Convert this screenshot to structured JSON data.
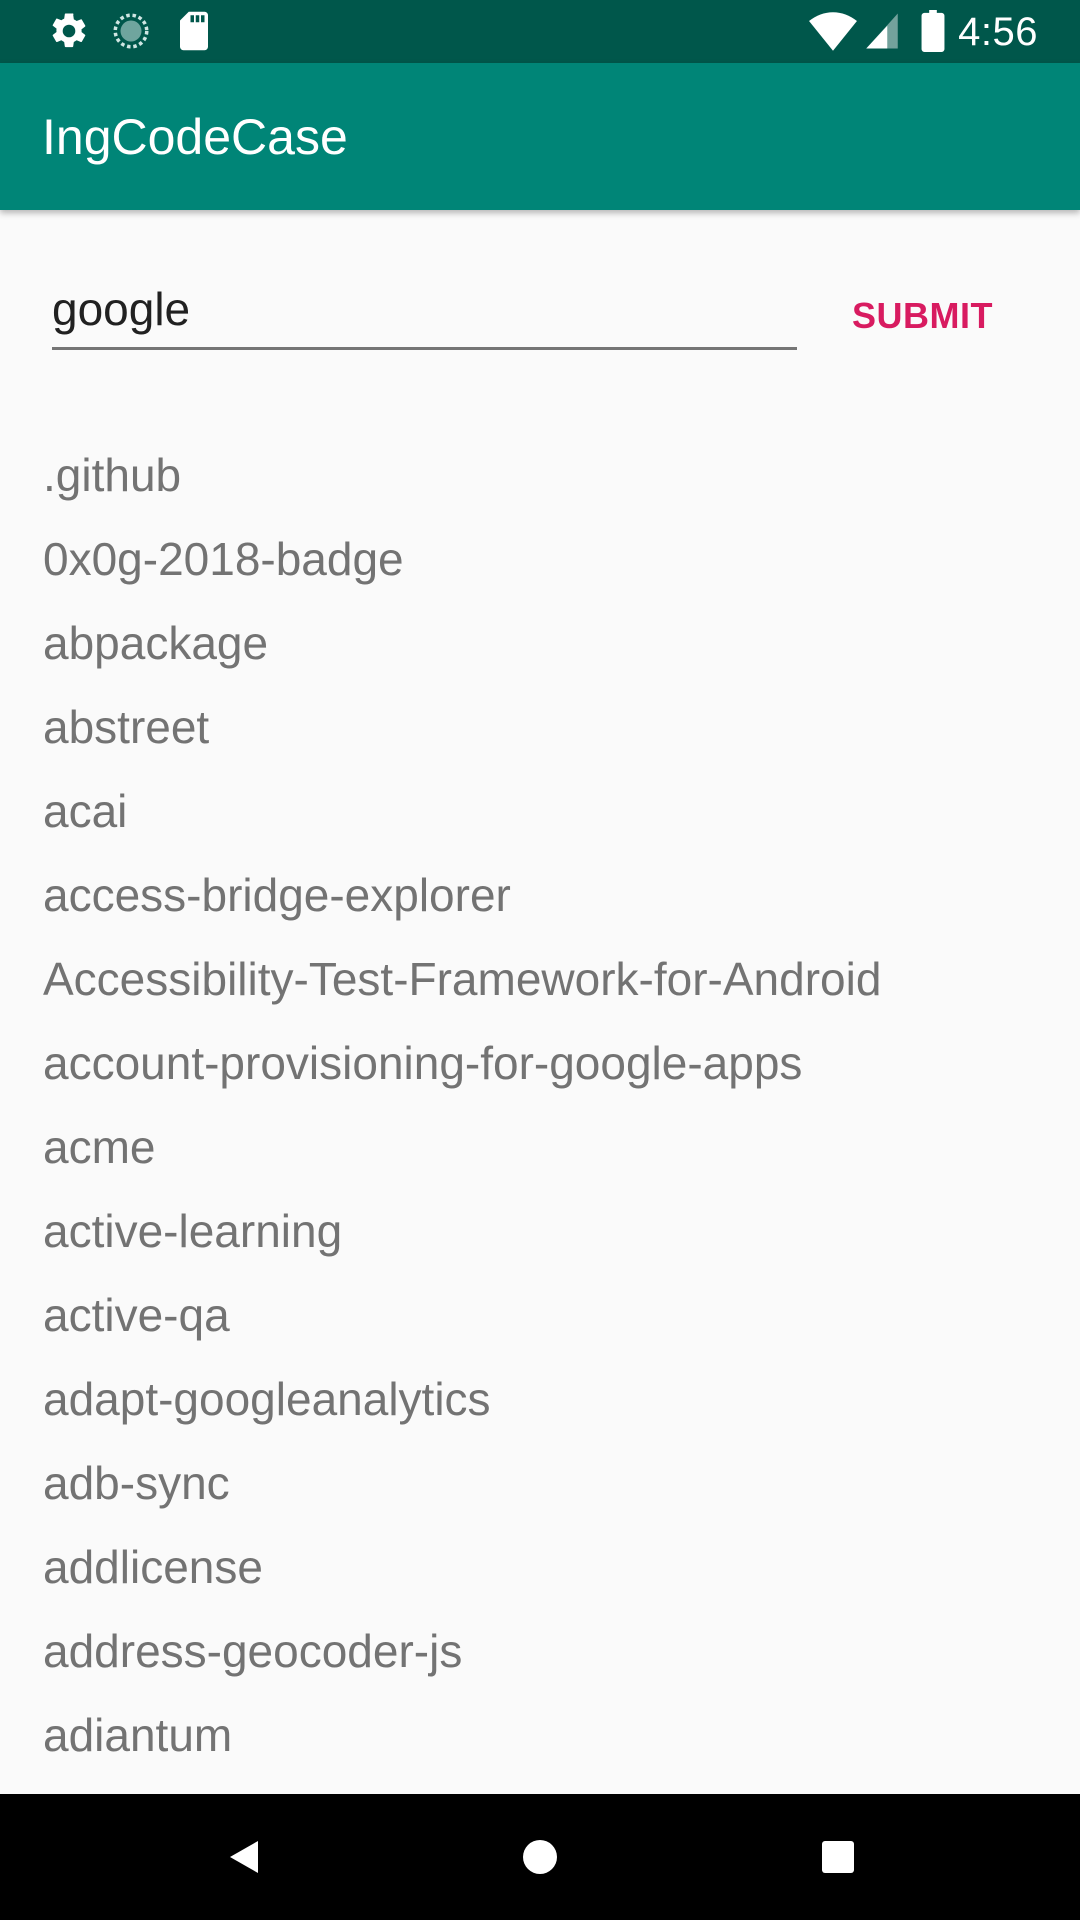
{
  "status_bar": {
    "time": "4:56",
    "icons": [
      "settings-icon",
      "sync-icon",
      "sd-card-icon",
      "wifi-icon",
      "signal-icon",
      "battery-icon"
    ]
  },
  "app_bar": {
    "title": "IngCodeCase",
    "color": "#008577",
    "status_color": "#00574b"
  },
  "search": {
    "value": "google",
    "submit_label": "SUBMIT",
    "accent_color": "#d81b60"
  },
  "repos": [
    ".github",
    "0x0g-2018-badge",
    "abpackage",
    "abstreet",
    "acai",
    "access-bridge-explorer",
    "Accessibility-Test-Framework-for-Android",
    "account-provisioning-for-google-apps",
    "acme",
    "active-learning",
    "active-qa",
    "adapt-googleanalytics",
    "adb-sync",
    "addlicense",
    "address-geocoder-js",
    "adiantum"
  ],
  "nav_bar": {
    "buttons": [
      "back-icon",
      "home-icon",
      "recents-icon"
    ]
  }
}
